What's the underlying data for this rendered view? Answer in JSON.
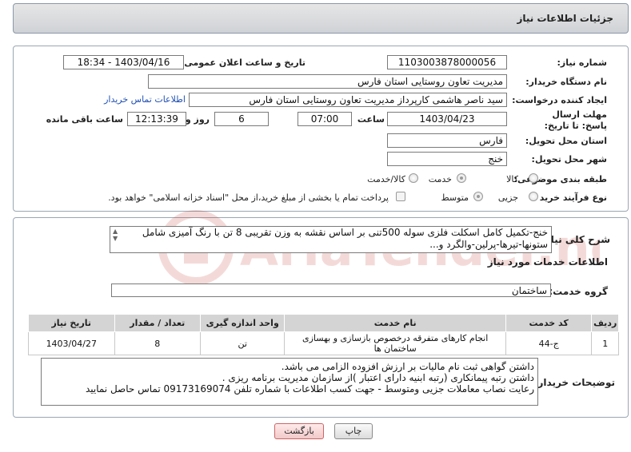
{
  "header": {
    "title": "جزئیات اطلاعات نیاز"
  },
  "form": {
    "need_number_label": "شماره نیاز:",
    "need_number": "1103003878000056",
    "announce_label": "تاریخ و ساعت اعلان عمومی:",
    "announce_value": "1403/04/16 - 18:34",
    "buyer_org_label": "نام دستگاه خریدار:",
    "buyer_org": "مدیریت تعاون روستایی استان فارس",
    "requester_label": "ایجاد کننده درخواست:",
    "requester": "سید ناصر هاشمی کارپرداز مدیریت تعاون روستایی استان فارس",
    "buyer_contact_link": "اطلاعات تماس خریدار",
    "deadline_label": "مهلت ارسال پاسخ: تا تاریخ:",
    "deadline_date": "1403/04/23",
    "time_label": "ساعت",
    "deadline_time": "07:00",
    "days_value": "6",
    "days_label": "روز و",
    "remaining_time": "12:13:39",
    "remaining_label": "ساعت باقی مانده",
    "province_label": "استان محل تحویل:",
    "province": "فارس",
    "city_label": "شهر محل تحویل:",
    "city": "خنج",
    "category_label": "طبقه بندی موضوعی:",
    "category_options": [
      "کالا",
      "خدمت",
      "کالا/خدمت"
    ],
    "process_label": "نوع فرآیند خرید :",
    "process_options": [
      "جزیی",
      "متوسط"
    ],
    "payment_note": "پرداخت تمام یا بخشی از مبلغ خرید،از محل \"اسناد خزانه اسلامی\" خواهد بود."
  },
  "summary": {
    "label": "شرح کلی نیاز:",
    "text": "خنج-تکمیل کامل اسکلت فلزی سوله 500تنی بر اساس نقشه به وزن تقریبی 8 تن با رنگ آمیزی شامل ستونها-تیرها-پرلین-والگرد و..."
  },
  "services": {
    "section_title": "اطلاعات خدمات مورد نیاز",
    "group_label": "گروه خدمت:",
    "group_value": "ساختمان",
    "columns": [
      "ردیف",
      "کد خدمت",
      "نام خدمت",
      "واحد اندازه گیری",
      "تعداد / مقدار",
      "تاریخ نیاز"
    ],
    "rows": [
      [
        "1",
        "ج-44",
        "انجام کارهای متفرقه درخصوص بازسازی و بهسازی ساختمان ها",
        "تن",
        "8",
        "1403/04/27"
      ]
    ]
  },
  "buyer_notes": {
    "label": "توضیحات خریدار:",
    "lines": [
      "داشتن گواهی ثبت نام مالیات بر ارزش افزوده الزامی می باشد.",
      "داشتن رتبه پیمانکاری (رتبه ابنیه دارای اعتبار )از سازمان مدیریت برنامه ریزی .",
      "رعایت نصاب معاملات جزیی ومتوسط - جهت کسب اطلاعات با شماره تلفن 09173169074 تماس حاصل نمایید"
    ]
  },
  "buttons": {
    "print": "چاپ",
    "back": "بازگشت"
  },
  "watermark": {
    "text": "AriaTender.neT"
  },
  "colors": {
    "link": "#1f4fb5",
    "watermark": "#c0392b"
  }
}
